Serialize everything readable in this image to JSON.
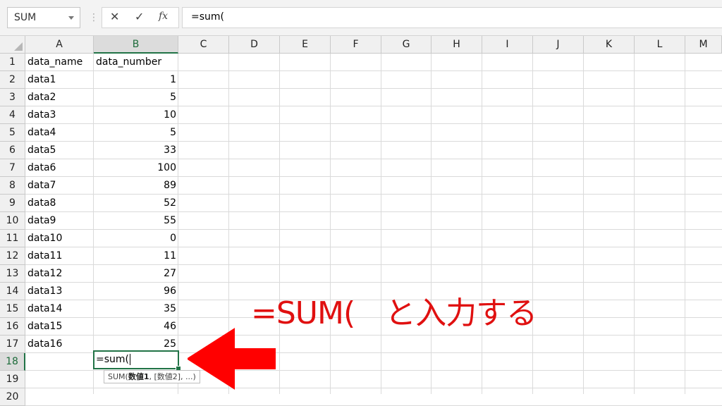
{
  "toolbar": {
    "name_box": "SUM",
    "separator": "⋮",
    "cancel_glyph": "✕",
    "confirm_glyph": "✓",
    "fx_label": "fx",
    "formula": "=sum("
  },
  "columns": [
    "A",
    "B",
    "C",
    "D",
    "E",
    "F",
    "G",
    "H",
    "I",
    "J",
    "K",
    "L",
    "M"
  ],
  "selected_column": "B",
  "rows": [
    {
      "n": "1",
      "a": "data_name",
      "b": "data_number"
    },
    {
      "n": "2",
      "a": "data1",
      "b": "1"
    },
    {
      "n": "3",
      "a": "data2",
      "b": "5"
    },
    {
      "n": "4",
      "a": "data3",
      "b": "10"
    },
    {
      "n": "5",
      "a": "data4",
      "b": "5"
    },
    {
      "n": "6",
      "a": "data5",
      "b": "33"
    },
    {
      "n": "7",
      "a": "data6",
      "b": "100"
    },
    {
      "n": "8",
      "a": "data7",
      "b": "89"
    },
    {
      "n": "9",
      "a": "data8",
      "b": "52"
    },
    {
      "n": "10",
      "a": "data9",
      "b": "55"
    },
    {
      "n": "11",
      "a": "data10",
      "b": "0"
    },
    {
      "n": "12",
      "a": "data11",
      "b": "11"
    },
    {
      "n": "13",
      "a": "data12",
      "b": "27"
    },
    {
      "n": "14",
      "a": "data13",
      "b": "96"
    },
    {
      "n": "15",
      "a": "data14",
      "b": "35"
    },
    {
      "n": "16",
      "a": "data15",
      "b": "46"
    },
    {
      "n": "17",
      "a": "data16",
      "b": "25"
    },
    {
      "n": "18",
      "a": "",
      "b": ""
    },
    {
      "n": "19",
      "a": "",
      "b": ""
    },
    {
      "n": "20",
      "a": "",
      "b": ""
    }
  ],
  "selected_row": "18",
  "active_cell": {
    "text": "=sum("
  },
  "tooltip": {
    "prefix": "SUM(",
    "arg1": "数値1",
    "rest": ", [数値2], ...)"
  },
  "annotation": {
    "text": "=SUM(　と入力する",
    "color": "#e01010"
  },
  "colors": {
    "accent": "#217346",
    "annotation": "#e01010"
  },
  "icons": {
    "cancel": "cancel-icon",
    "confirm": "confirm-icon",
    "function": "fx-icon",
    "arrow": "arrow-left-icon"
  }
}
